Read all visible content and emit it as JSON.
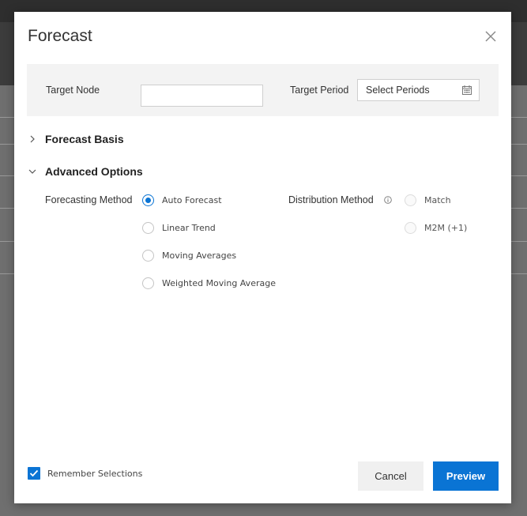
{
  "modal": {
    "title": "Forecast",
    "target_node_label": "Target Node",
    "target_node_value": "",
    "target_period_label": "Target Period",
    "target_period_placeholder": "Select Periods",
    "forecast_basis_label": "Forecast Basis",
    "advanced_options_label": "Advanced Options",
    "forecasting_method_label": "Forecasting Method",
    "forecasting_methods": [
      "Auto Forecast",
      "Linear Trend",
      "Moving Averages",
      "Weighted Moving Average"
    ],
    "selected_forecasting_method": "Auto Forecast",
    "distribution_method_label": "Distribution Method",
    "distribution_methods": [
      "Match",
      "M2M (+1)"
    ],
    "remember_label": "Remember Selections",
    "remember_checked": true,
    "cancel_label": "Cancel",
    "preview_label": "Preview"
  },
  "colors": {
    "accent": "#0a74d4",
    "panel_bg": "#f3f3f3",
    "cancel_bg": "#f0f0f0",
    "overlay": "#6f6f6f"
  },
  "icons": [
    "close-icon",
    "calendar-icon",
    "chevron-right-icon",
    "chevron-down-icon",
    "info-icon",
    "checkmark-icon"
  ]
}
